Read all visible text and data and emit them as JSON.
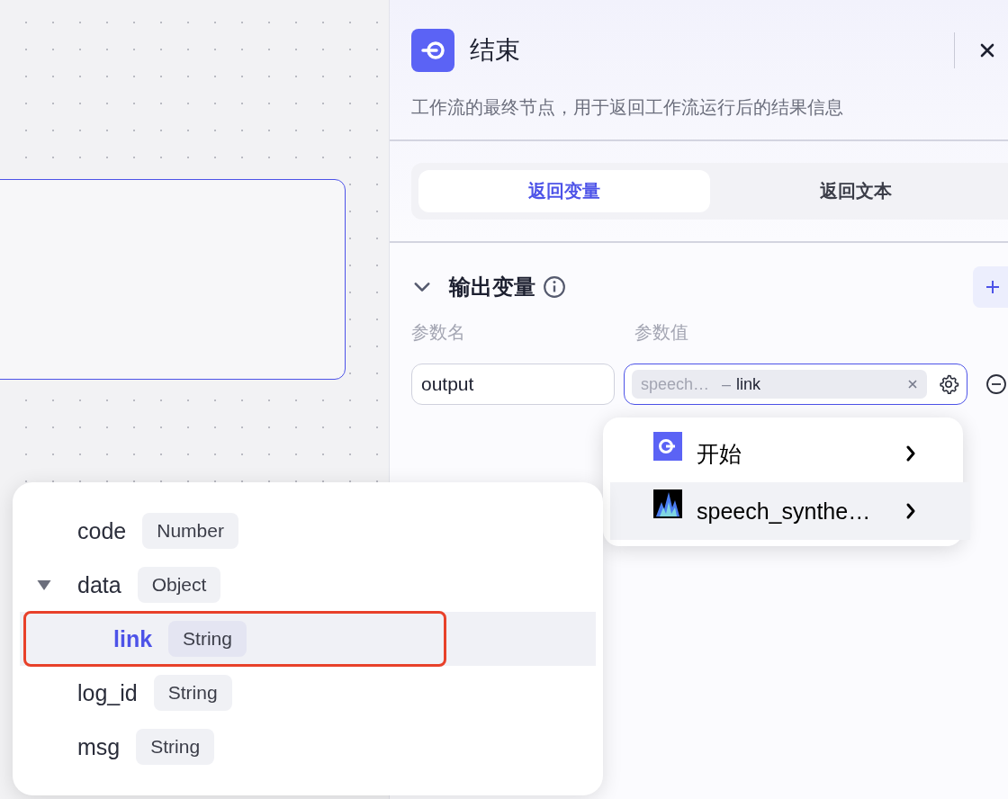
{
  "panel": {
    "title": "结束",
    "description": "工作流的最终节点，用于返回工作流运行后的结果信息",
    "tabs": [
      {
        "label": "返回变量",
        "selected": true
      },
      {
        "label": "返回文本",
        "selected": false
      }
    ],
    "section": {
      "title": "输出变量",
      "expanded": true,
      "columns": [
        "参数名",
        "参数值"
      ],
      "rows": [
        {
          "name": "output",
          "value": {
            "source": "speech…",
            "separator": "–",
            "field": "link"
          }
        }
      ]
    }
  },
  "node_menu": [
    {
      "label": "开始",
      "kind": "start",
      "selected": false
    },
    {
      "label": "speech_synthe…",
      "kind": "plugin",
      "selected": true
    }
  ],
  "field_tree": [
    {
      "name": "code",
      "type": "Number",
      "selected": false
    },
    {
      "name": "data",
      "type": "Object",
      "selected": false,
      "expanded": true,
      "children": [
        {
          "name": "link",
          "type": "String",
          "selected": true
        }
      ]
    },
    {
      "name": "log_id",
      "type": "String",
      "selected": false
    },
    {
      "name": "msg",
      "type": "String",
      "selected": false
    }
  ]
}
